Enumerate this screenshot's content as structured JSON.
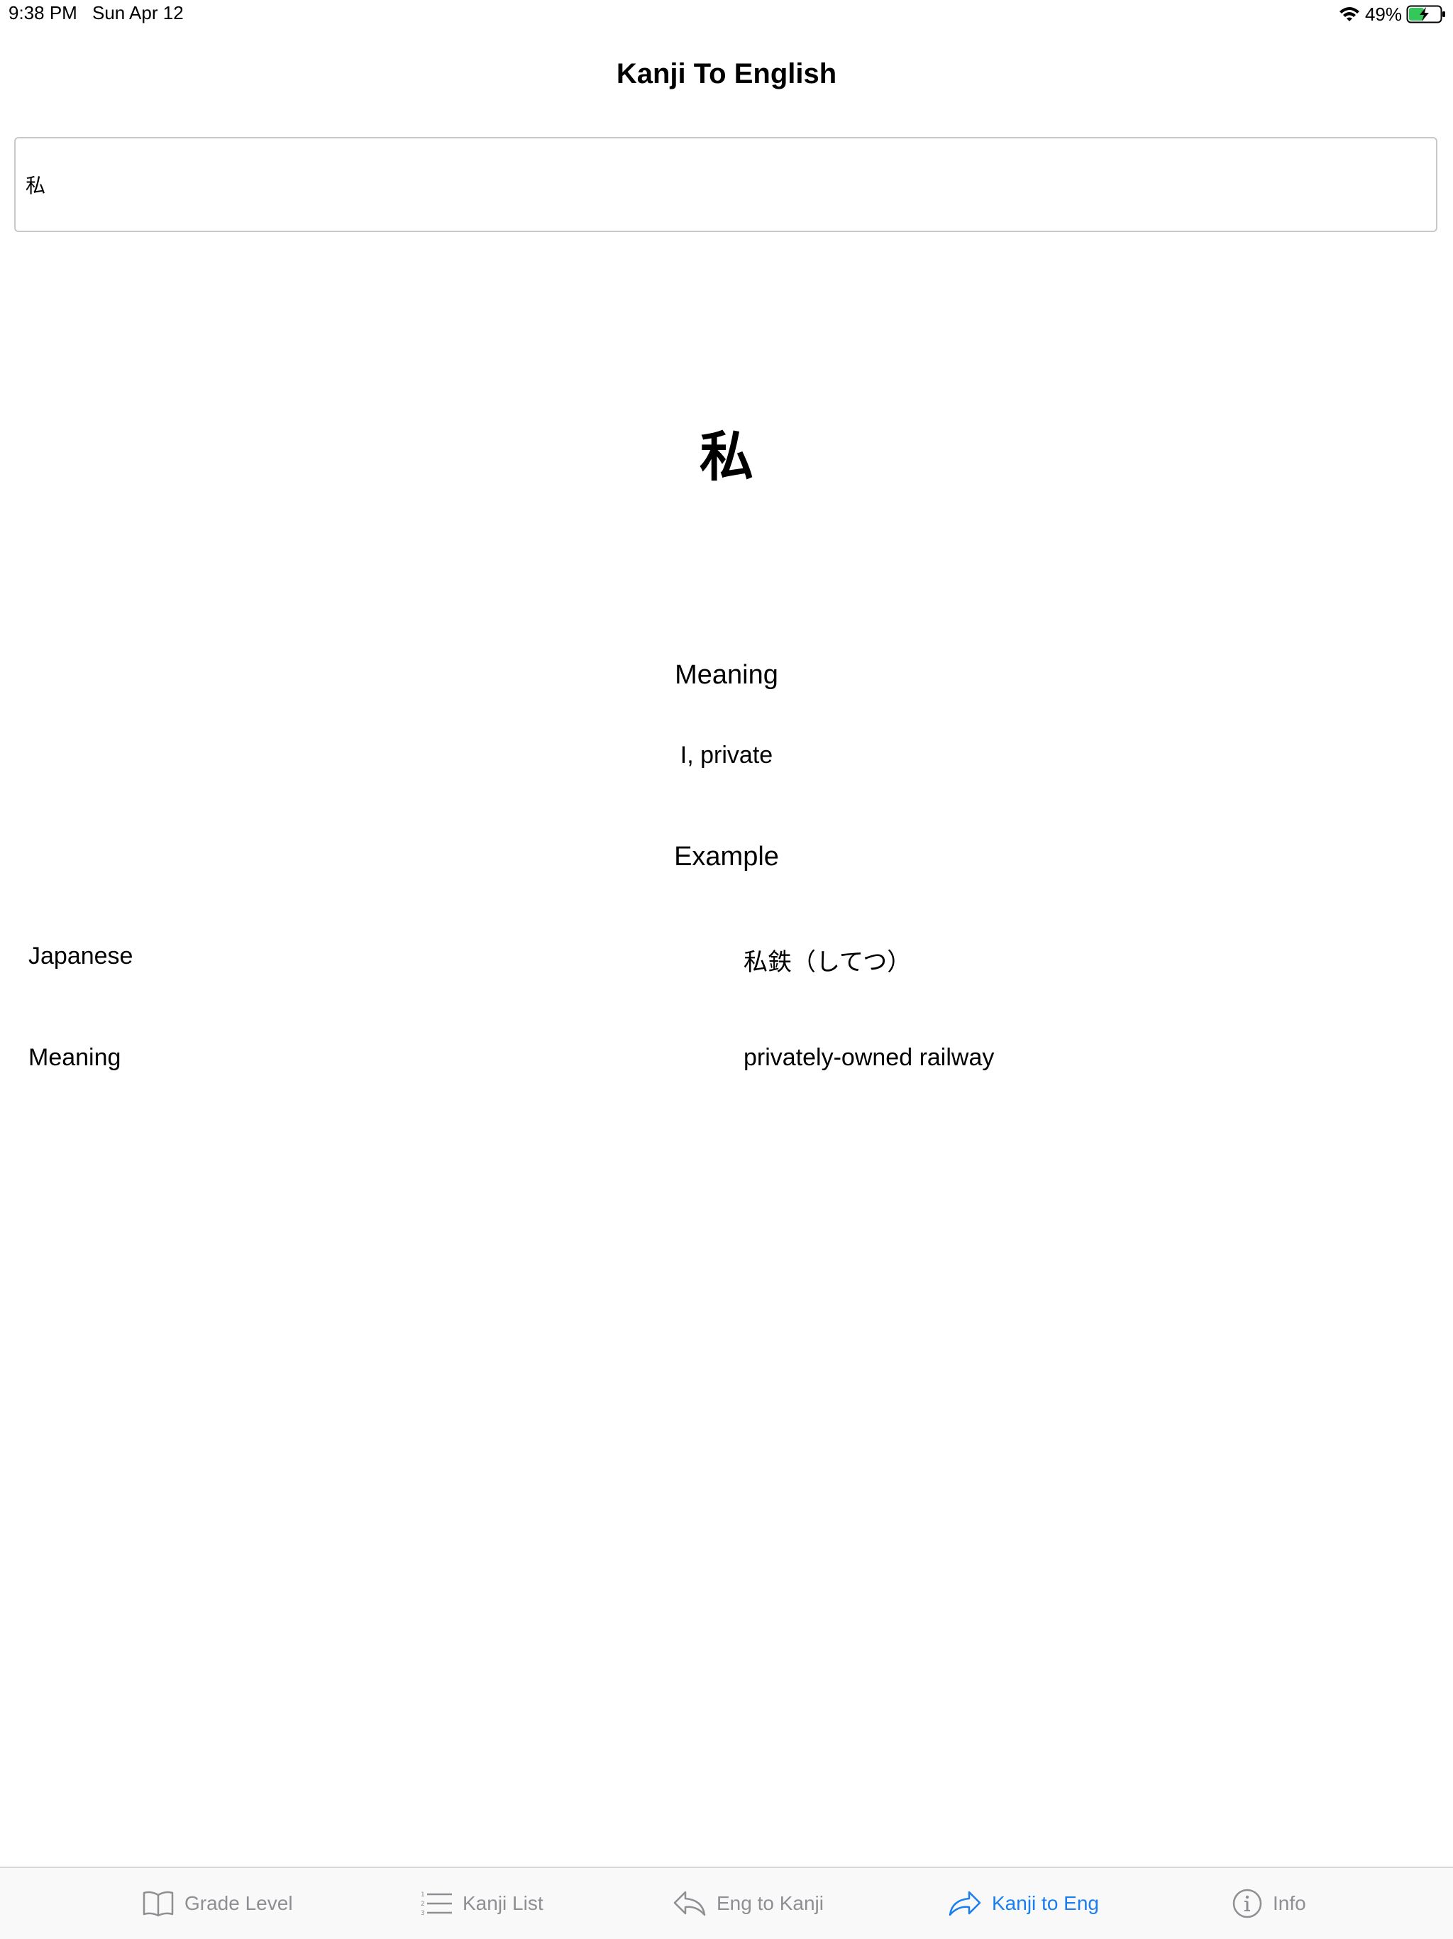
{
  "status_bar": {
    "time": "9:38 PM",
    "date": "Sun Apr 12",
    "battery_percent": "49%",
    "battery_level": 0.49
  },
  "header": {
    "title": "Kanji To English"
  },
  "search": {
    "value": "私"
  },
  "kanji": {
    "character": "私"
  },
  "meaning_section": {
    "heading": "Meaning",
    "value": "I, private"
  },
  "example_section": {
    "heading": "Example",
    "rows": [
      {
        "label": "Japanese",
        "value": "私鉄（してつ）"
      },
      {
        "label": "Meaning",
        "value": "privately-owned railway"
      }
    ]
  },
  "tab_bar": {
    "active_color": "#1a7ef0",
    "inactive_color": "#8e8e93",
    "tabs": [
      {
        "label": "Grade Level",
        "icon": "book-icon",
        "active": false
      },
      {
        "label": "Kanji List",
        "icon": "list-icon",
        "active": false
      },
      {
        "label": "Eng to Kanji",
        "icon": "reply-arrow-icon",
        "active": false
      },
      {
        "label": "Kanji to Eng",
        "icon": "forward-arrow-icon",
        "active": true
      },
      {
        "label": "Info",
        "icon": "info-icon",
        "active": false
      }
    ]
  }
}
